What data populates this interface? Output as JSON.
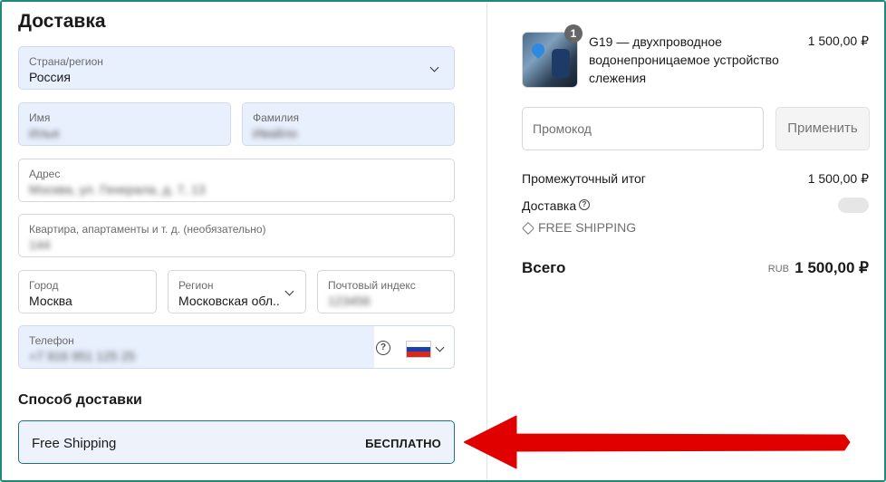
{
  "delivery": {
    "title": "Доставка",
    "country": {
      "label": "Страна/регион",
      "value": "Россия"
    },
    "first_name": {
      "label": "Имя",
      "value": "Илья"
    },
    "last_name": {
      "label": "Фамилия",
      "value": "Ивайло"
    },
    "address": {
      "label": "Адрес",
      "value": "Москва, ул. Генерала, д. 7, 13"
    },
    "apartment": {
      "label": "Квартира, апартаменты и т. д. (необязательно)",
      "value": "144"
    },
    "city": {
      "label": "Город",
      "value": "Москва"
    },
    "region": {
      "label": "Регион",
      "value": "Московская обл..."
    },
    "postal": {
      "label": "Почтовый индекс",
      "value": "123456"
    },
    "phone": {
      "label": "Телефон",
      "value": "+7 916 951 125 25"
    }
  },
  "shipping_method": {
    "title": "Способ доставки",
    "option_name": "Free Shipping",
    "option_price": "БЕСПЛАТНО"
  },
  "summary": {
    "item": {
      "quantity": "1",
      "name": "G19 — двухпроводное водонепроницаемое устройство слежения",
      "price": "1 500,00 ₽"
    },
    "promo_placeholder": "Промокод",
    "apply_label": "Применить",
    "subtotal_label": "Промежуточный итог",
    "subtotal_value": "1 500,00 ₽",
    "shipping_label": "Доставка",
    "free_shipping_tag": "FREE SHIPPING",
    "total_label": "Всего",
    "currency": "RUB",
    "total_value": "1 500,00 ₽"
  },
  "colors": {
    "accent_border": "#1f8a7a",
    "selected_border": "#1c6f8a",
    "arrow": "#e00000"
  },
  "icons": [
    "chevron-down-icon",
    "help-icon",
    "russia-flag-icon",
    "tag-icon",
    "red-arrow-annotation"
  ]
}
